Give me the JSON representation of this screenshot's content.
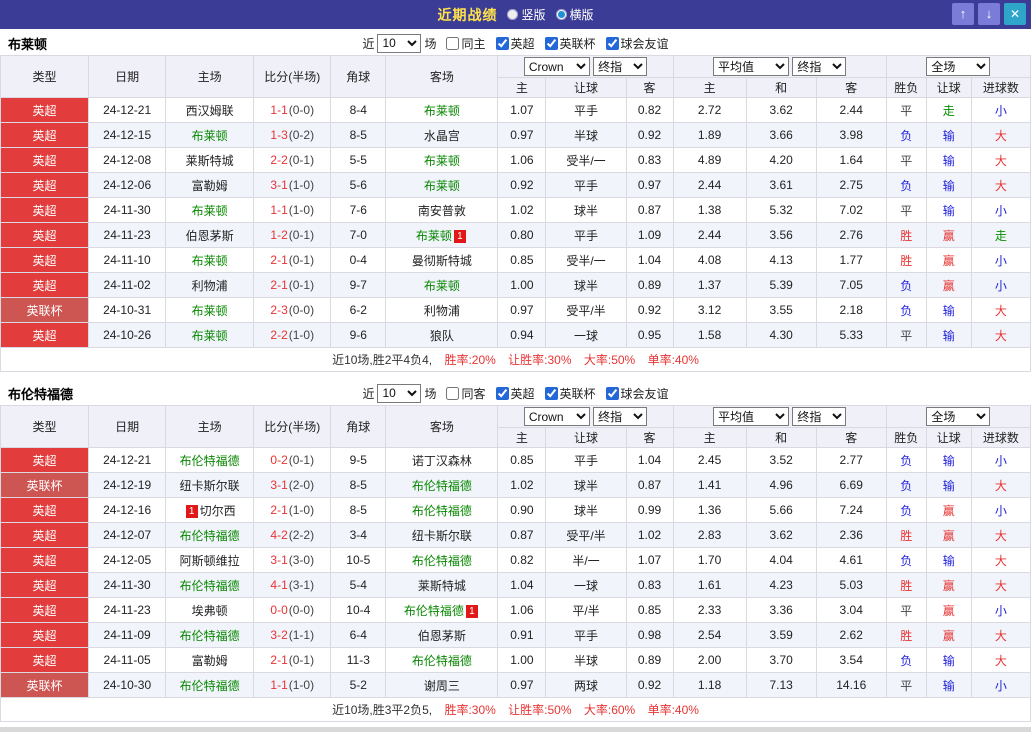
{
  "titlebar": {
    "title": "近期战绩",
    "vertical_label": "竖版",
    "horizontal_label": "横版",
    "up_icon": "↑",
    "down_icon": "↓",
    "close_icon": "✕"
  },
  "colors": {
    "titlebar_bg": "#3b3c96",
    "title_text": "#ffe24a",
    "league_epl_bg": "#e23c3c",
    "league_cup_bg": "#cd5552",
    "win_red": "#e73333",
    "lose_blue": "#2222dd",
    "draw_green": "#089000",
    "team_green": "#088700"
  },
  "table_header": {
    "type": "类型",
    "date": "日期",
    "home": "主场",
    "score": "比分(半场)",
    "corner": "角球",
    "away": "客场",
    "bookmaker_select": "Crown",
    "final_index_select": "终指",
    "average_select": "平均值",
    "scope_select": "全场",
    "odds_home": "主",
    "odds_handicap": "让球",
    "odds_away": "客",
    "avg_home": "主",
    "avg_draw": "和",
    "avg_away": "客",
    "result_wdl": "胜负",
    "result_handicap": "让球",
    "result_goals": "进球数"
  },
  "sections": [
    {
      "team": "布莱顿",
      "filter": {
        "near_label": "近",
        "count": "10",
        "games_label": "场",
        "same_label": "同主",
        "same_checked": false,
        "leagues": [
          {
            "label": "英超",
            "checked": true
          },
          {
            "label": "英联杯",
            "checked": true
          },
          {
            "label": "球会友谊",
            "checked": true
          }
        ]
      },
      "rows": [
        {
          "league": "英超",
          "cup": false,
          "date": "24-12-21",
          "home": "西汉姆联",
          "home_green": false,
          "away": "布莱顿",
          "away_green": true,
          "score_ft": "1-1",
          "score_ht": "(0-0)",
          "corner": "8-4",
          "odds_home": "1.07",
          "handicap": "平手",
          "odds_away": "0.82",
          "avg_home": "2.72",
          "avg_draw": "3.62",
          "avg_away": "2.44",
          "res_wdl": "平",
          "res_handicap": "走",
          "res_goals": "小"
        },
        {
          "league": "英超",
          "cup": false,
          "date": "24-12-15",
          "home": "布莱顿",
          "home_green": true,
          "away": "水晶宫",
          "away_green": false,
          "score_ft": "1-3",
          "score_ht": "(0-2)",
          "corner": "8-5",
          "odds_home": "0.97",
          "handicap": "半球",
          "odds_away": "0.92",
          "avg_home": "1.89",
          "avg_draw": "3.66",
          "avg_away": "3.98",
          "res_wdl": "负",
          "res_handicap": "输",
          "res_goals": "大"
        },
        {
          "league": "英超",
          "cup": false,
          "date": "24-12-08",
          "home": "莱斯特城",
          "home_green": false,
          "away": "布莱顿",
          "away_green": true,
          "score_ft": "2-2",
          "score_ht": "(0-1)",
          "corner": "5-5",
          "odds_home": "1.06",
          "handicap": "受半/一",
          "odds_away": "0.83",
          "avg_home": "4.89",
          "avg_draw": "4.20",
          "avg_away": "1.64",
          "res_wdl": "平",
          "res_handicap": "输",
          "res_goals": "大"
        },
        {
          "league": "英超",
          "cup": false,
          "date": "24-12-06",
          "home": "富勒姆",
          "home_green": false,
          "away": "布莱顿",
          "away_green": true,
          "score_ft": "3-1",
          "score_ht": "(1-0)",
          "corner": "5-6",
          "odds_home": "0.92",
          "handicap": "平手",
          "odds_away": "0.97",
          "avg_home": "2.44",
          "avg_draw": "3.61",
          "avg_away": "2.75",
          "res_wdl": "负",
          "res_handicap": "输",
          "res_goals": "大"
        },
        {
          "league": "英超",
          "cup": false,
          "date": "24-11-30",
          "home": "布莱顿",
          "home_green": true,
          "away": "南安普敦",
          "away_green": false,
          "score_ft": "1-1",
          "score_ht": "(1-0)",
          "corner": "7-6",
          "odds_home": "1.02",
          "handicap": "球半",
          "odds_away": "0.87",
          "avg_home": "1.38",
          "avg_draw": "5.32",
          "avg_away": "7.02",
          "res_wdl": "平",
          "res_handicap": "输",
          "res_goals": "小"
        },
        {
          "league": "英超",
          "cup": false,
          "date": "24-11-23",
          "home": "伯恩茅斯",
          "home_green": false,
          "away": "布莱顿",
          "away_green": true,
          "away_card": "1",
          "score_ft": "1-2",
          "score_ht": "(0-1)",
          "corner": "7-0",
          "odds_home": "0.80",
          "handicap": "平手",
          "odds_away": "1.09",
          "avg_home": "2.44",
          "avg_draw": "3.56",
          "avg_away": "2.76",
          "res_wdl": "胜",
          "res_handicap": "赢",
          "res_goals": "走"
        },
        {
          "league": "英超",
          "cup": false,
          "date": "24-11-10",
          "home": "布莱顿",
          "home_green": true,
          "away": "曼彻斯特城",
          "away_green": false,
          "score_ft": "2-1",
          "score_ht": "(0-1)",
          "corner": "0-4",
          "odds_home": "0.85",
          "handicap": "受半/一",
          "odds_away": "1.04",
          "avg_home": "4.08",
          "avg_draw": "4.13",
          "avg_away": "1.77",
          "res_wdl": "胜",
          "res_handicap": "赢",
          "res_goals": "小"
        },
        {
          "league": "英超",
          "cup": false,
          "date": "24-11-02",
          "home": "利物浦",
          "home_green": false,
          "away": "布莱顿",
          "away_green": true,
          "score_ft": "2-1",
          "score_ht": "(0-1)",
          "corner": "9-7",
          "odds_home": "1.00",
          "handicap": "球半",
          "odds_away": "0.89",
          "avg_home": "1.37",
          "avg_draw": "5.39",
          "avg_away": "7.05",
          "res_wdl": "负",
          "res_handicap": "赢",
          "res_goals": "小"
        },
        {
          "league": "英联杯",
          "cup": true,
          "date": "24-10-31",
          "home": "布莱顿",
          "home_green": true,
          "away": "利物浦",
          "away_green": false,
          "score_ft": "2-3",
          "score_ht": "(0-0)",
          "corner": "6-2",
          "odds_home": "0.97",
          "handicap": "受平/半",
          "odds_away": "0.92",
          "avg_home": "3.12",
          "avg_draw": "3.55",
          "avg_away": "2.18",
          "res_wdl": "负",
          "res_handicap": "输",
          "res_goals": "大"
        },
        {
          "league": "英超",
          "cup": false,
          "date": "24-10-26",
          "home": "布莱顿",
          "home_green": true,
          "away": "狼队",
          "away_green": false,
          "score_ft": "2-2",
          "score_ht": "(1-0)",
          "corner": "9-6",
          "odds_home": "0.94",
          "handicap": "一球",
          "odds_away": "0.95",
          "avg_home": "1.58",
          "avg_draw": "4.30",
          "avg_away": "5.33",
          "res_wdl": "平",
          "res_handicap": "输",
          "res_goals": "大"
        }
      ],
      "summary": {
        "prefix": "近10场,胜2平4负4,",
        "stats": [
          "胜率:20%",
          "让胜率:30%",
          "大率:50%",
          "单率:40%"
        ]
      }
    },
    {
      "team": "布伦特福德",
      "filter": {
        "near_label": "近",
        "count": "10",
        "games_label": "场",
        "same_label": "同客",
        "same_checked": false,
        "leagues": [
          {
            "label": "英超",
            "checked": true
          },
          {
            "label": "英联杯",
            "checked": true
          },
          {
            "label": "球会友谊",
            "checked": true
          }
        ]
      },
      "rows": [
        {
          "league": "英超",
          "cup": false,
          "date": "24-12-21",
          "home": "布伦特福德",
          "home_green": true,
          "away": "诺丁汉森林",
          "away_green": false,
          "score_ft": "0-2",
          "score_ht": "(0-1)",
          "corner": "9-5",
          "odds_home": "0.85",
          "handicap": "平手",
          "odds_away": "1.04",
          "avg_home": "2.45",
          "avg_draw": "3.52",
          "avg_away": "2.77",
          "res_wdl": "负",
          "res_handicap": "输",
          "res_goals": "小"
        },
        {
          "league": "英联杯",
          "cup": true,
          "date": "24-12-19",
          "home": "纽卡斯尔联",
          "home_green": false,
          "away": "布伦特福德",
          "away_green": true,
          "score_ft": "3-1",
          "score_ht": "(2-0)",
          "corner": "8-5",
          "odds_home": "1.02",
          "handicap": "球半",
          "odds_away": "0.87",
          "avg_home": "1.41",
          "avg_draw": "4.96",
          "avg_away": "6.69",
          "res_wdl": "负",
          "res_handicap": "输",
          "res_goals": "大"
        },
        {
          "league": "英超",
          "cup": false,
          "date": "24-12-16",
          "home": "切尔西",
          "home_green": false,
          "home_card": "1",
          "home_card_pos": "before",
          "away": "布伦特福德",
          "away_green": true,
          "score_ft": "2-1",
          "score_ht": "(1-0)",
          "corner": "8-5",
          "odds_home": "0.90",
          "handicap": "球半",
          "odds_away": "0.99",
          "avg_home": "1.36",
          "avg_draw": "5.66",
          "avg_away": "7.24",
          "res_wdl": "负",
          "res_handicap": "赢",
          "res_goals": "小"
        },
        {
          "league": "英超",
          "cup": false,
          "date": "24-12-07",
          "home": "布伦特福德",
          "home_green": true,
          "away": "纽卡斯尔联",
          "away_green": false,
          "score_ft": "4-2",
          "score_ht": "(2-2)",
          "corner": "3-4",
          "odds_home": "0.87",
          "handicap": "受平/半",
          "odds_away": "1.02",
          "avg_home": "2.83",
          "avg_draw": "3.62",
          "avg_away": "2.36",
          "res_wdl": "胜",
          "res_handicap": "赢",
          "res_goals": "大"
        },
        {
          "league": "英超",
          "cup": false,
          "date": "24-12-05",
          "home": "阿斯顿维拉",
          "home_green": false,
          "away": "布伦特福德",
          "away_green": true,
          "score_ft": "3-1",
          "score_ht": "(3-0)",
          "corner": "10-5",
          "odds_home": "0.82",
          "handicap": "半/一",
          "odds_away": "1.07",
          "avg_home": "1.70",
          "avg_draw": "4.04",
          "avg_away": "4.61",
          "res_wdl": "负",
          "res_handicap": "输",
          "res_goals": "大"
        },
        {
          "league": "英超",
          "cup": false,
          "date": "24-11-30",
          "home": "布伦特福德",
          "home_green": true,
          "away": "莱斯特城",
          "away_green": false,
          "score_ft": "4-1",
          "score_ht": "(3-1)",
          "corner": "5-4",
          "odds_home": "1.04",
          "handicap": "一球",
          "odds_away": "0.83",
          "avg_home": "1.61",
          "avg_draw": "4.23",
          "avg_away": "5.03",
          "res_wdl": "胜",
          "res_handicap": "赢",
          "res_goals": "大"
        },
        {
          "league": "英超",
          "cup": false,
          "date": "24-11-23",
          "home": "埃弗顿",
          "home_green": false,
          "away": "布伦特福德",
          "away_green": true,
          "away_card": "1",
          "score_ft": "0-0",
          "score_ht": "(0-0)",
          "corner": "10-4",
          "odds_home": "1.06",
          "handicap": "平/半",
          "odds_away": "0.85",
          "avg_home": "2.33",
          "avg_draw": "3.36",
          "avg_away": "3.04",
          "res_wdl": "平",
          "res_handicap": "赢",
          "res_goals": "小"
        },
        {
          "league": "英超",
          "cup": false,
          "date": "24-11-09",
          "home": "布伦特福德",
          "home_green": true,
          "away": "伯恩茅斯",
          "away_green": false,
          "score_ft": "3-2",
          "score_ht": "(1-1)",
          "corner": "6-4",
          "odds_home": "0.91",
          "handicap": "平手",
          "odds_away": "0.98",
          "avg_home": "2.54",
          "avg_draw": "3.59",
          "avg_away": "2.62",
          "res_wdl": "胜",
          "res_handicap": "赢",
          "res_goals": "大"
        },
        {
          "league": "英超",
          "cup": false,
          "date": "24-11-05",
          "home": "富勒姆",
          "home_green": false,
          "away": "布伦特福德",
          "away_green": true,
          "score_ft": "2-1",
          "score_ht": "(0-1)",
          "corner": "11-3",
          "odds_home": "1.00",
          "handicap": "半球",
          "odds_away": "0.89",
          "avg_home": "2.00",
          "avg_draw": "3.70",
          "avg_away": "3.54",
          "res_wdl": "负",
          "res_handicap": "输",
          "res_goals": "大"
        },
        {
          "league": "英联杯",
          "cup": true,
          "date": "24-10-30",
          "home": "布伦特福德",
          "home_green": true,
          "away": "谢周三",
          "away_green": false,
          "score_ft": "1-1",
          "score_ht": "(1-0)",
          "corner": "5-2",
          "odds_home": "0.97",
          "handicap": "两球",
          "odds_away": "0.92",
          "avg_home": "1.18",
          "avg_draw": "7.13",
          "avg_away": "14.16",
          "res_wdl": "平",
          "res_handicap": "输",
          "res_goals": "小"
        }
      ],
      "summary": {
        "prefix": "近10场,胜3平2负5,",
        "stats": [
          "胜率:30%",
          "让胜率:50%",
          "大率:60%",
          "单率:40%"
        ]
      }
    }
  ]
}
